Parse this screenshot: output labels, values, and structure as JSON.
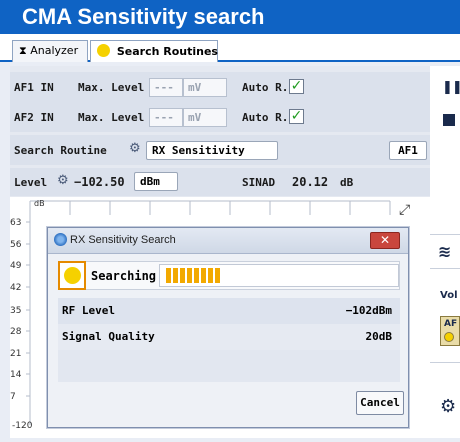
{
  "app": {
    "title": "CMA Sensitivity search"
  },
  "tabs": [
    {
      "label": "Analyzer",
      "icon": "hourglass-icon"
    },
    {
      "label": "Search Routines",
      "icon": "yellow-dot-icon"
    }
  ],
  "af1": {
    "label": "AF1 IN",
    "max_level_label": "Max. Level",
    "value": "---",
    "unit": "mV",
    "auto_label": "Auto R.",
    "auto_checked": true
  },
  "af2": {
    "label": "AF2 IN",
    "max_level_label": "Max. Level",
    "value": "---",
    "unit": "mV",
    "auto_label": "Auto R.",
    "auto_checked": true
  },
  "search_routine": {
    "label": "Search Routine",
    "value": "RX Sensitivity",
    "af_button": "AF1"
  },
  "level": {
    "label": "Level",
    "value": "−102.50",
    "unit": "dBm",
    "sinad_label": "SINAD",
    "sinad_value": "20.12",
    "sinad_unit": "dB"
  },
  "chart": {
    "unit_label": "dB",
    "y_ticks": [
      "63",
      "56",
      "49",
      "42",
      "35",
      "28",
      "21",
      "14",
      "7"
    ],
    "x_first_tick": "-120"
  },
  "dialog": {
    "title": "RX Sensitivity Search",
    "status_label": "Searching",
    "progress_segments": 8,
    "rows": [
      {
        "label": "RF Level",
        "value": "−102dBm"
      },
      {
        "label": "Signal Quality",
        "value": "20dB"
      }
    ],
    "cancel_label": "Cancel"
  },
  "right_panel": {
    "vol_label": "Vol",
    "af_label": "AF"
  },
  "colors": {
    "accent": "#0f63c4",
    "progress": "#f2a900",
    "close": "#c9463d",
    "check": "#1f9b1f"
  }
}
